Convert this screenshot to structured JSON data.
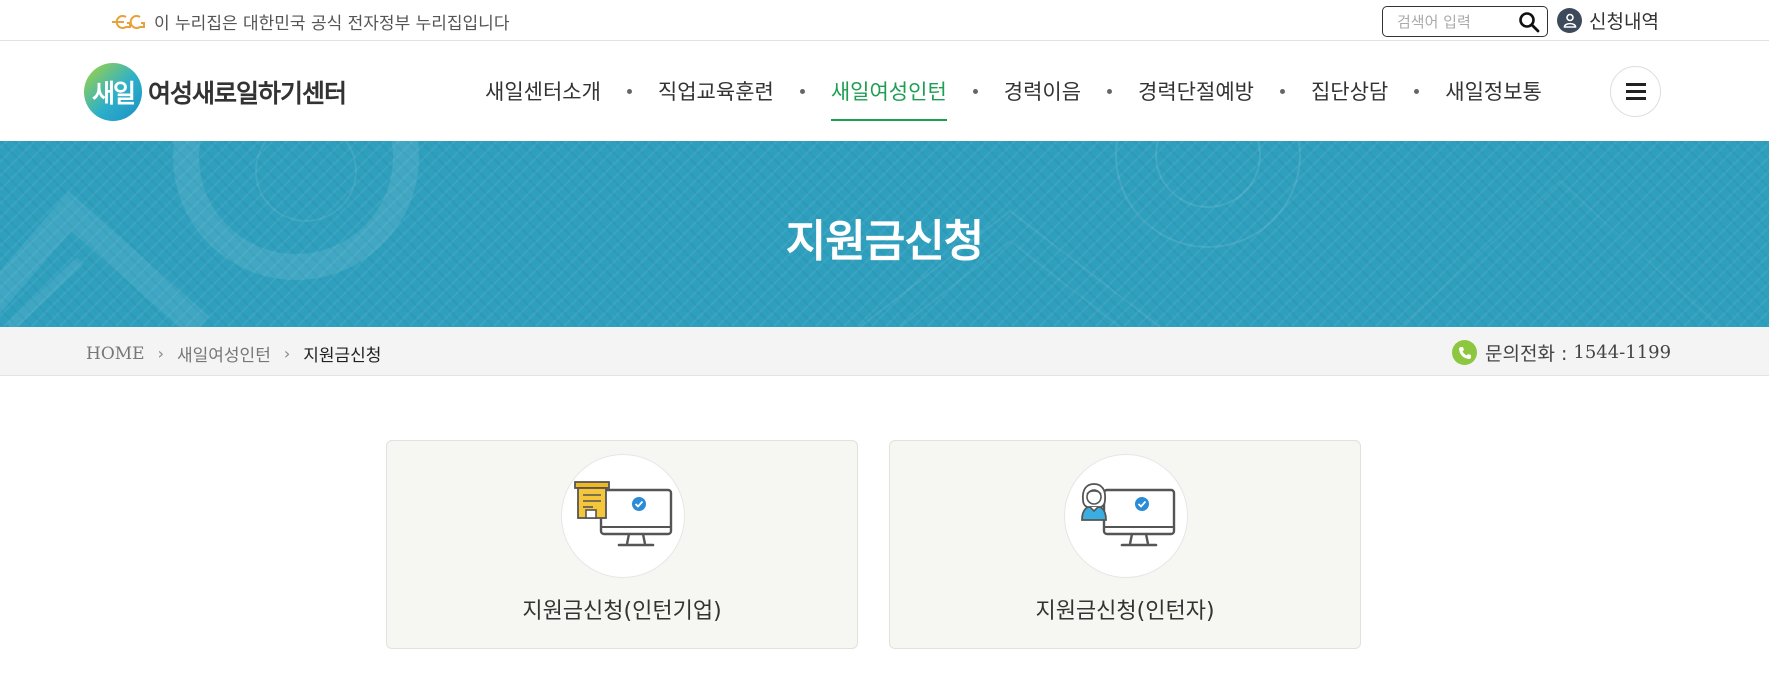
{
  "gov_notice": {
    "text": "이 누리집은 대한민국 공식 전자정부 누리집입니다"
  },
  "search": {
    "placeholder": "검색어 입력"
  },
  "user_menu": {
    "label": "신청내역"
  },
  "logo": {
    "mark": "새일",
    "text": "여성새로일하기센터"
  },
  "nav": {
    "items": [
      {
        "label": "새일센터소개",
        "active": false
      },
      {
        "label": "직업교육훈련",
        "active": false
      },
      {
        "label": "새일여성인턴",
        "active": true
      },
      {
        "label": "경력이음",
        "active": false
      },
      {
        "label": "경력단절예방",
        "active": false
      },
      {
        "label": "집단상담",
        "active": false
      },
      {
        "label": "새일정보통",
        "active": false
      }
    ]
  },
  "banner": {
    "title": "지원금신청"
  },
  "breadcrumb": {
    "home": "HOME",
    "level1": "새일여성인턴",
    "current": "지원금신청"
  },
  "contact": {
    "label": "문의전화 :",
    "number": "1544-1199"
  },
  "cards": [
    {
      "label": "지원금신청(인턴기업)",
      "icon": "company-computer-icon"
    },
    {
      "label": "지원금신청(인턴자)",
      "icon": "intern-computer-icon"
    }
  ],
  "colors": {
    "banner": "#2f9fbe",
    "active_nav": "#1e9e52",
    "phone_icon": "#8dc63f",
    "card_bg": "#f6f6f2"
  }
}
